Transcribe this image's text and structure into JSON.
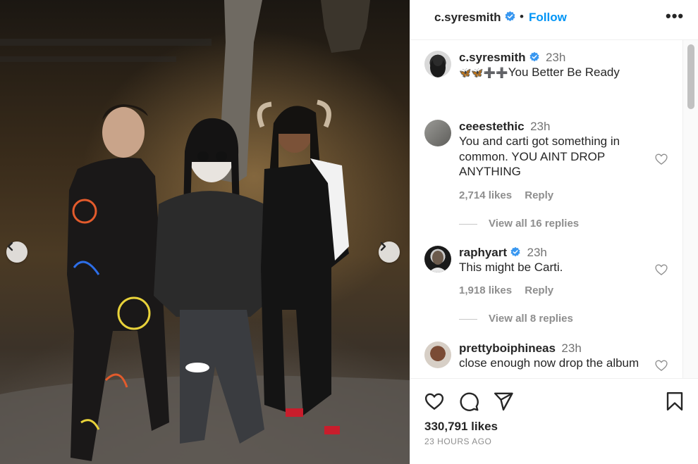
{
  "header": {
    "username": "c.syresmith",
    "separator": "•",
    "follow_label": "Follow",
    "more_label": "•••"
  },
  "caption": {
    "username": "c.syresmith",
    "time": "23h",
    "emoji": "🦋🦋➕➕",
    "text": "You Better Be Ready"
  },
  "comments": [
    {
      "username": "ceeestethic",
      "time": "23h",
      "text": "You and carti got something in common. YOU AINT DROP ANYTHING",
      "likes": "2,714 likes",
      "reply_label": "Reply",
      "view_replies": "View all 16 replies"
    },
    {
      "username": "raphyart",
      "time": "23h",
      "text": "This might be Carti.",
      "likes": "1,918 likes",
      "reply_label": "Reply",
      "view_replies": "View all 8 replies"
    },
    {
      "username": "prettyboiphineas",
      "time": "23h",
      "text": "close enough now drop the album"
    }
  ],
  "post": {
    "likes": "330,791 likes",
    "time_ago": "23 HOURS AGO"
  },
  "icons": {
    "verified": "verified-badge-icon",
    "like": "heart-icon",
    "comment": "comment-bubble-icon",
    "share": "paper-plane-icon",
    "save": "bookmark-icon",
    "prev": "chevron-left-icon",
    "next": "chevron-right-icon"
  },
  "colors": {
    "accent": "#0095f6",
    "verified": "#3897f0",
    "muted": "#8e8e8e"
  }
}
